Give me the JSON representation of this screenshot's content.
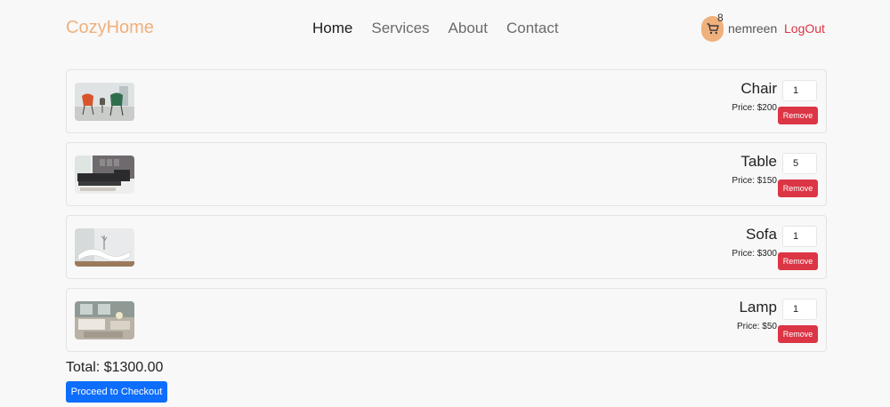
{
  "brand": "CozyHome",
  "nav": {
    "home": "Home",
    "services": "Services",
    "about": "About",
    "contact": "Contact"
  },
  "user": {
    "cart_count": "8",
    "name": "nemreen",
    "logout": "LogOut"
  },
  "cart_items": [
    {
      "name": "Chair",
      "price": "Price: $200",
      "quantity": "1",
      "remove_label": "Remove",
      "thumb": "chairs-photo"
    },
    {
      "name": "Table",
      "price": "Price: $150",
      "quantity": "5",
      "remove_label": "Remove",
      "thumb": "sofa-room-photo"
    },
    {
      "name": "Sofa",
      "price": "Price: $300",
      "quantity": "1",
      "remove_label": "Remove",
      "thumb": "chaise-lounge-photo"
    },
    {
      "name": "Lamp",
      "price": "Price: $50",
      "quantity": "1",
      "remove_label": "Remove",
      "thumb": "living-room-photo"
    }
  ],
  "total": "Total: $1300.00",
  "checkout_label": "Proceed to Checkout",
  "colors": {
    "brand": "#f0b07c",
    "danger": "#dc3545",
    "primary": "#0d6efd",
    "background": "#f8f8f8"
  }
}
